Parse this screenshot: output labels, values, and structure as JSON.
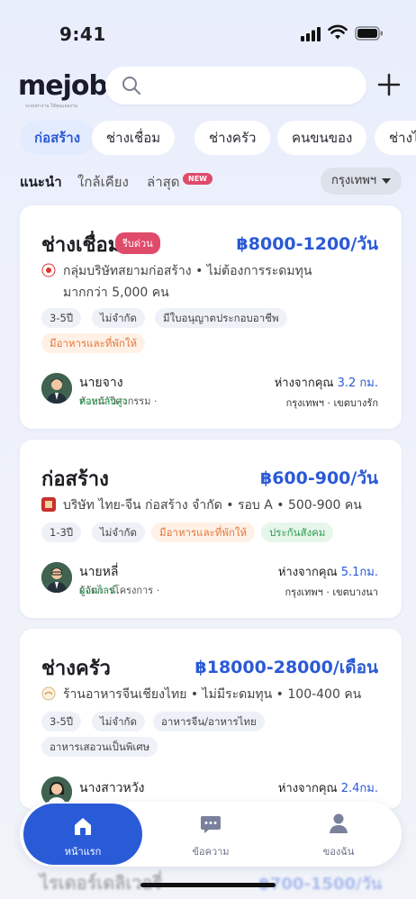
{
  "status_bar": {
    "time": "9:41"
  },
  "header": {
    "logo": "mejob",
    "logo_tagline": "ระบบหางาน ให้คุณเจองาน",
    "search_placeholder": ""
  },
  "categories": [
    "ก่อสร้าง",
    "ช่างเชื่อม",
    "ช่างครัว",
    "คนขนของ",
    "ช่างไฟ"
  ],
  "active_category": "ก่อสร้าง",
  "sort_tabs": [
    "แนะนำ",
    "ใกล้เคียง",
    "ล่าสุด"
  ],
  "new_badge": "NEW",
  "region_filter": "กรุงเทพฯ",
  "jobs": [
    {
      "title": "ช่างเชื่อม",
      "urgent": "รีบด่วน",
      "salary": "฿8000-1200/วัน",
      "company": "กลุ่มบริษัทสยามก่อสร้าง • ไม่ต้องการระดมทุน",
      "company_sub": "มากกว่า 5,000 คน",
      "tags": [
        "3-5ปี",
        "ไม่จำกัด",
        "มีใบอนุญาตประกอบอาชีพ",
        "มีอาหารและที่พักให้"
      ],
      "recruiter": "นายจาง",
      "role": "หัวหน้าวิศวกรรม",
      "status": "ตอบกลับสูง",
      "distance_label": "ห่างจากคุณ",
      "distance": "3.2 กม.",
      "location": "กรุงเทพฯ · เขตบางรัก"
    },
    {
      "title": "ก่อสร้าง",
      "salary": "฿600-900/วัน",
      "company": "บริษัท ไทย-จีน ก่อสร้าง จำกัด • รอบ A • 500-900 คน",
      "tags": [
        "1-3ปี",
        "ไม่จำกัด",
        "มีอาหารและที่พักให้",
        "ประกันสังคม"
      ],
      "recruiter": "นายหลี่",
      "role": "ผู้จัดการโครงการ",
      "status": "ออนไลน์",
      "distance_label": "ห่างจากคุณ",
      "distance": "5.1กม.",
      "location": "กรุงเทพฯ · เขตบางนา"
    },
    {
      "title": "ช่างครัว",
      "salary": "฿18000-28000/เดือน",
      "company": "ร้านอาหารจีนเชียงไทย • ไม่มีระดมทุน • 100-400 คน",
      "tags": [
        "3-5ปี",
        "ไม่จำกัด",
        "อาหารจีน/อาหารไทย",
        "อาหารเสอวนเป็นพิเศษ"
      ],
      "recruiter": "นางสาวหวัง",
      "distance_label": "ห่างจากคุณ",
      "distance": "2.4กม."
    }
  ],
  "peek_job": {
    "title": "ไรเดอร์เดลิเวอรี่",
    "salary": "฿700-1500/วัน"
  },
  "bottom_nav": [
    {
      "label": "หน้าแรก",
      "icon": "home-icon",
      "active": true
    },
    {
      "label": "ข้อความ",
      "icon": "message-icon",
      "active": false
    },
    {
      "label": "ของฉัน",
      "icon": "profile-icon",
      "active": false
    }
  ],
  "colors": {
    "accent": "#2b5ad6",
    "urgent": "#e04b6b",
    "green": "#2f9d55",
    "orange": "#e3783a"
  }
}
